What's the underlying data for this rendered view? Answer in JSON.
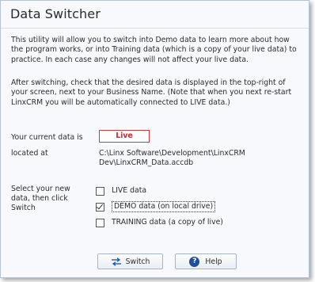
{
  "window": {
    "title": "Data Switcher"
  },
  "intro": {
    "p1": "This utility will allow you to switch into Demo data to learn more about how the program works, or into Training data (which is a copy of your live data) to practice. In each case any changes will not affect your live data.",
    "p2": "After switching, check that the desired data is displayed in the top-right of your screen, next to your Business Name. (Note that when you next re-start LinxCRM you will be automatically connected to LIVE data.)"
  },
  "current": {
    "label": "Your current data is",
    "value": "Live",
    "value_color": "#e02020",
    "location_label": "located at",
    "path": "C:\\Linx Software\\Development\\LinxCRM Dev\\LinxCRM_Data.accdb"
  },
  "select": {
    "label": "Select your new data, then click Switch",
    "options": [
      {
        "label": "LIVE data",
        "checked": false
      },
      {
        "label": "DEMO data (on local drive)",
        "checked": true
      },
      {
        "label": "TRAINING data (a copy of live)",
        "checked": false
      }
    ]
  },
  "buttons": {
    "switch_label": "Switch",
    "switch_icon": "switch-arrows-icon",
    "help_label": "Help",
    "help_icon": "help-question-icon",
    "help_icon_glyph": "?"
  }
}
